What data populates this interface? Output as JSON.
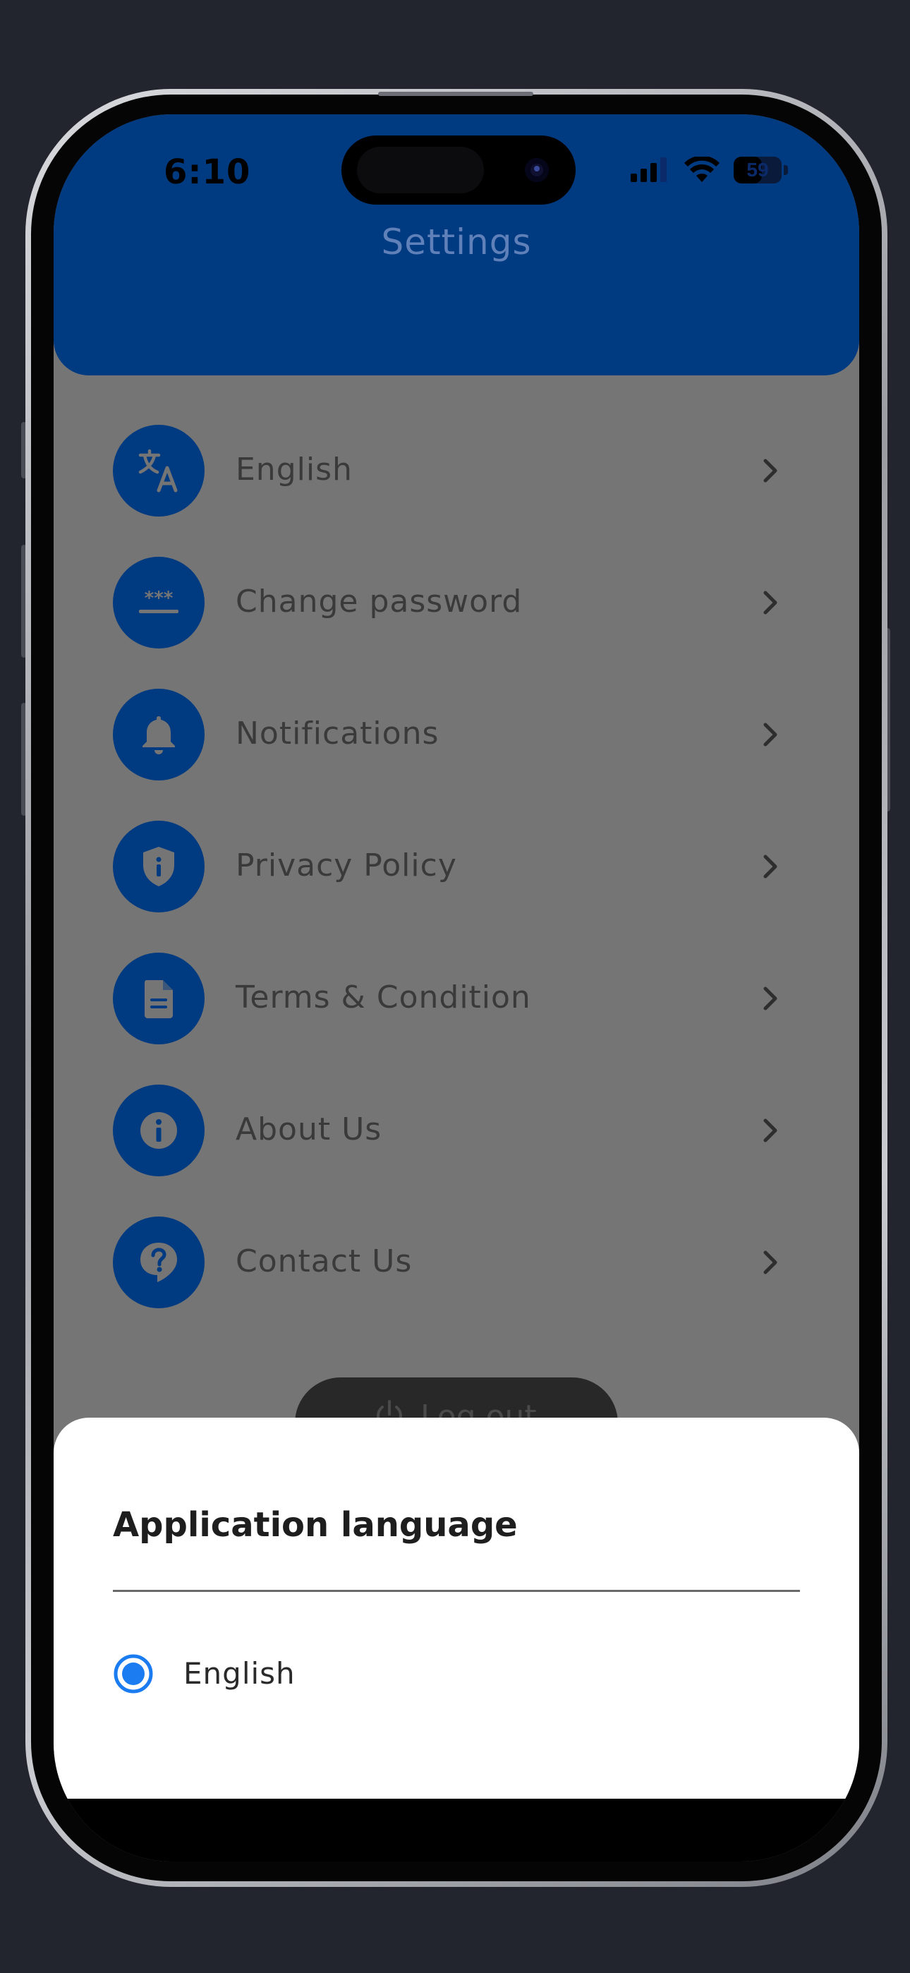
{
  "status_bar": {
    "time": "6:10",
    "battery": "59",
    "battery_level": 0.59,
    "icons": [
      "signal-icon",
      "wifi-icon",
      "battery-icon"
    ]
  },
  "header": {
    "title": "Settings"
  },
  "settings": {
    "items": [
      {
        "label": "English",
        "icon": "translate-icon"
      },
      {
        "label": "Change password",
        "icon": "password-icon"
      },
      {
        "label": "Notifications",
        "icon": "bell-icon"
      },
      {
        "label": "Privacy Policy",
        "icon": "shield-icon"
      },
      {
        "label": "Terms & Condition",
        "icon": "document-icon"
      },
      {
        "label": "About Us",
        "icon": "info-icon"
      },
      {
        "label": "Contact Us",
        "icon": "help-bubble-icon"
      }
    ],
    "logout_label": "Log out"
  },
  "language_sheet": {
    "title": "Application language",
    "options": [
      {
        "label": "English",
        "selected": true
      }
    ]
  },
  "colors": {
    "primary": "#003a80",
    "overlay": "#757575",
    "radio_selected": "#1a7cf0",
    "background": "#22252d"
  }
}
